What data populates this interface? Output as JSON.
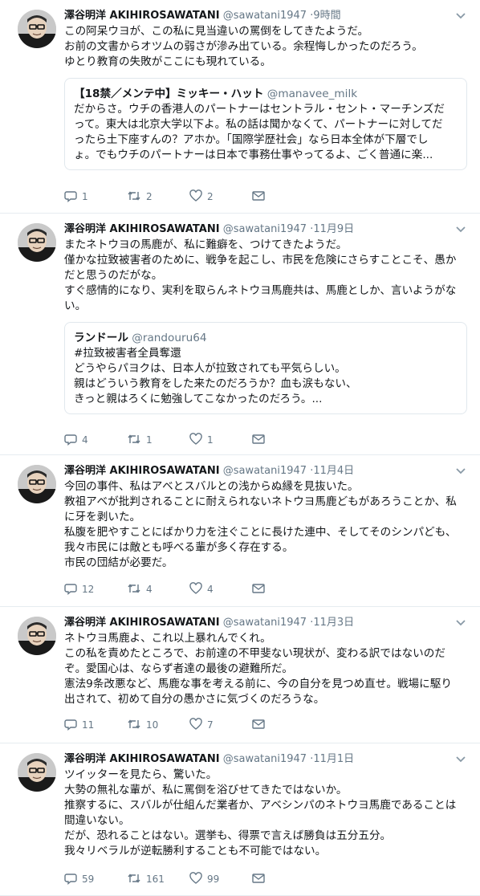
{
  "tweets": [
    {
      "name": "澤谷明洋 AKIHIROSAWATANI",
      "handle": "@sawatani1947",
      "sep": "·",
      "time": "9時間",
      "lines": [
        "この阿呆ウヨが、この私に見当違いの罵倒をしてきたようだ。",
        "お前の文書からオツムの弱さが滲み出ている。余程悔しかったのだろう。",
        "ゆとり教育の失敗がここにも現れている。"
      ],
      "quote": {
        "name": "【18禁／メンテ中】ミッキー・ハット",
        "handle": "@manavee_milk",
        "lines": [
          "だからさ。ウチの香港人のパートナーはセントラル・セント・マーチンズだ",
          "って。東大は北京大学以下よ。私の話は聞かなくて、パートナーに対してだ",
          "ったら土下座すんの？アホか。「国際学歴社会」なら日本全体が下層でし",
          "ょ。でもウチのパートナーは日本で事務仕事やってるよ、ごく普通に楽..."
        ]
      },
      "reply_count": "1",
      "retweet_count": "2",
      "like_count": "2"
    },
    {
      "name": "澤谷明洋 AKIHIROSAWATANI",
      "handle": "@sawatani1947",
      "sep": "·",
      "time": "11月9日",
      "lines": [
        "またネトウヨの馬鹿が、私に難癖を、つけてきたようだ。",
        "僅かな拉致被害者のために、戦争を起こし、市民を危険にさらすことこそ、愚か",
        "だと思うのだがな。",
        "すぐ感情的になり、実利を取らんネトウヨ馬鹿共は、馬鹿としか、言いようがな",
        "い。"
      ],
      "quote": {
        "name": "ランドール",
        "handle": "@randouru64",
        "lines": [
          "#拉致被害者全員奪還",
          "どうやらパヨクは、日本人が拉致されても平気らしい。",
          "親はどういう教育をした来たのだろうか？血も涙もない、",
          "きっと親はろくに勉強してこなかったのだろう。..."
        ]
      },
      "reply_count": "4",
      "retweet_count": "1",
      "like_count": "1"
    },
    {
      "name": "澤谷明洋 AKIHIROSAWATANI",
      "handle": "@sawatani1947",
      "sep": "·",
      "time": "11月4日",
      "lines": [
        "今回の事件、私はアベとスバルとの浅からぬ縁を見抜いた。",
        "教祖アベが批判されることに耐えられないネトウヨ馬鹿どもがあろうことか、私",
        "に牙を剥いた。",
        "私腹を肥やすことにばかり力を注ぐことに長けた連中、そしてそのシンパども、",
        "我々市民には敵とも呼べる輩が多く存在する。",
        "市民の団結が必要だ。"
      ],
      "quote": null,
      "reply_count": "12",
      "retweet_count": "4",
      "like_count": "4"
    },
    {
      "name": "澤谷明洋 AKIHIROSAWATANI",
      "handle": "@sawatani1947",
      "sep": "·",
      "time": "11月3日",
      "lines": [
        "ネトウヨ馬鹿よ、これ以上暴れんでくれ。",
        "この私を責めたところで、お前達の不甲斐ない現状が、変わる訳ではないのだ",
        "ぞ。愛国心は、ならず者達の最後の避難所だ。",
        "憲法9条改悪など、馬鹿な事を考える前に、今の自分を見つめ直せ。戦場に駆り",
        "出されて、初めて自分の愚かさに気づくのだろうな。"
      ],
      "quote": null,
      "reply_count": "11",
      "retweet_count": "10",
      "like_count": "7"
    },
    {
      "name": "澤谷明洋 AKIHIROSAWATANI",
      "handle": "@sawatani1947",
      "sep": "·",
      "time": "11月1日",
      "lines": [
        "ツイッターを見たら、驚いた。",
        "大勢の無礼な輩が、私に罵倒を浴びせてきたではないか。",
        "推察するに、スバルが仕組んだ業者か、アベシンパのネトウヨ馬鹿であることは",
        "間違いない。",
        "だが、恐れることはない。選挙も、得票で言えば勝負は五分五分。",
        "我々リベラルが逆転勝利することも不可能ではない。"
      ],
      "quote": null,
      "reply_count": "59",
      "retweet_count": "161",
      "like_count": "99"
    }
  ],
  "icons": {
    "reply": "reply-icon",
    "retweet": "retweet-icon",
    "like": "heart-icon",
    "dm": "envelope-icon",
    "menu": "chevron-down-icon"
  }
}
